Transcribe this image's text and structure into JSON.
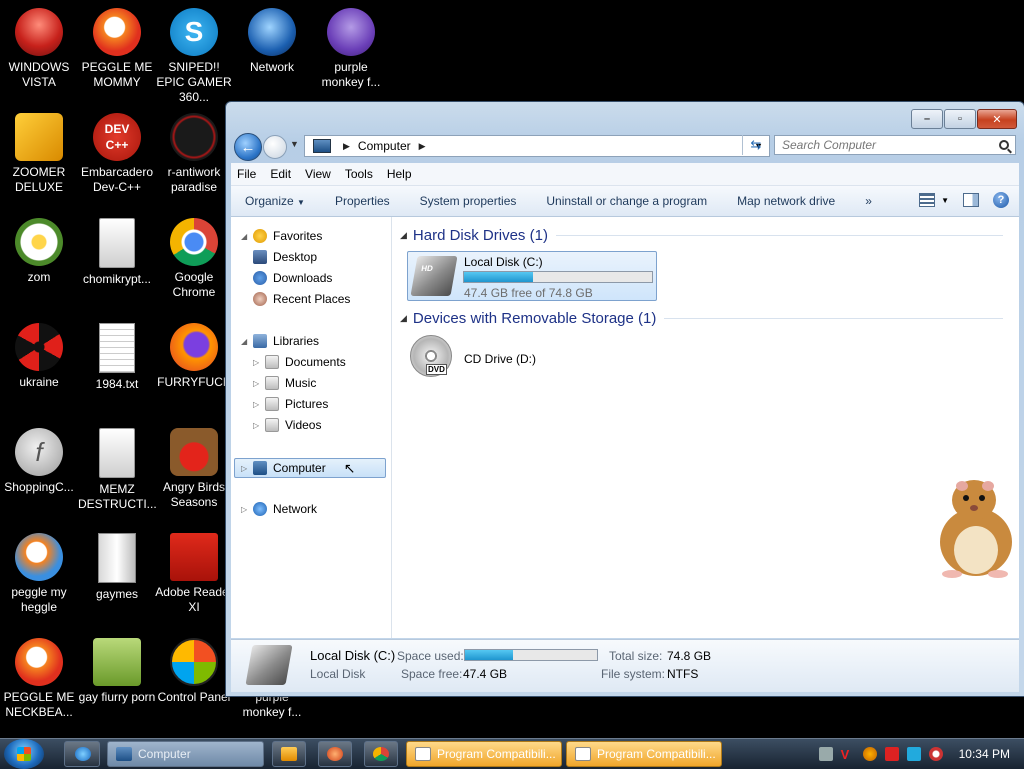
{
  "desktop": {
    "icons": [
      {
        "label": "WINDOWS VISTA",
        "icon": "vista-orb-icon"
      },
      {
        "label": "PEGGLE ME MOMMY",
        "icon": "peggle-icon"
      },
      {
        "label": "SNIPED!! EPIC GAMER 360...",
        "icon": "skype-icon"
      },
      {
        "label": "Network",
        "icon": "network-globe-icon"
      },
      {
        "label": "purple monkey f...",
        "icon": "bonzi-icon"
      },
      {
        "label": "ZOOMER DELUXE",
        "icon": "zoomer-icon"
      },
      {
        "label": "Embarcadero Dev-C++",
        "icon": "devcpp-icon"
      },
      {
        "label": "r-antiwork paradise",
        "icon": "reddit-icon"
      },
      {
        "label": "zom",
        "icon": "flower-icon"
      },
      {
        "label": "chomikrypt...",
        "icon": "file-icon"
      },
      {
        "label": "Google Chrome",
        "icon": "chrome-icon"
      },
      {
        "label": "ukraine",
        "icon": "radiation-icon"
      },
      {
        "label": "1984.txt",
        "icon": "text-file-icon"
      },
      {
        "label": "FURRYFUCK",
        "icon": "firefox-icon"
      },
      {
        "label": "ShoppingC...",
        "icon": "flash-icon"
      },
      {
        "label": "MEMZ DESTRUCTI...",
        "icon": "file-icon"
      },
      {
        "label": "Angry Birds Seasons",
        "icon": "angry-birds-icon"
      },
      {
        "label": "peggle my heggle",
        "icon": "peggle-icon"
      },
      {
        "label": "gaymes",
        "icon": "folder-icon"
      },
      {
        "label": "Adobe Reader XI",
        "icon": "adobe-reader-icon"
      },
      {
        "label": "PEGGLE ME NECKBEA...",
        "icon": "peggle-icon"
      },
      {
        "label": "gay fiurry porn",
        "icon": "bear-box-icon"
      },
      {
        "label": "Control Panel",
        "icon": "control-panel-icon"
      },
      {
        "label": "purple monkey f...",
        "icon": "bonzi-icon"
      }
    ]
  },
  "window": {
    "address": {
      "segment": "Computer"
    },
    "search_placeholder": "Search Computer",
    "menu": [
      "File",
      "Edit",
      "View",
      "Tools",
      "Help"
    ],
    "commands": [
      "Organize",
      "Properties",
      "System properties",
      "Uninstall or change a program",
      "Map network drive",
      "»"
    ],
    "nav": {
      "favorites": "Favorites",
      "desktop": "Desktop",
      "downloads": "Downloads",
      "recent": "Recent Places",
      "libraries": "Libraries",
      "documents": "Documents",
      "music": "Music",
      "pictures": "Pictures",
      "videos": "Videos",
      "computer": "Computer",
      "network": "Network"
    },
    "groups": {
      "hdd": "Hard Disk Drives (1)",
      "removable": "Devices with Removable Storage (1)"
    },
    "drive_c": {
      "name": "Local Disk (C:)",
      "free_text": "47.4 GB free of 74.8 GB",
      "used_fraction": 0.366
    },
    "drive_d": {
      "name": "CD Drive (D:)"
    },
    "details": {
      "name": "Local Disk (C:)",
      "type": "Local Disk",
      "space_used_label": "Space used:",
      "space_free_label": "Space free:",
      "space_free": "47.4 GB",
      "total_label": "Total size:",
      "total": "74.8 GB",
      "fs_label": "File system:",
      "fs": "NTFS"
    }
  },
  "taskbar": {
    "buttons": [
      "Computer",
      "Program Compatibili...",
      "Program Compatibili..."
    ],
    "clock": "10:34 PM"
  },
  "colors": {
    "accent": "#1f96cf",
    "group_header": "#1e3287"
  }
}
